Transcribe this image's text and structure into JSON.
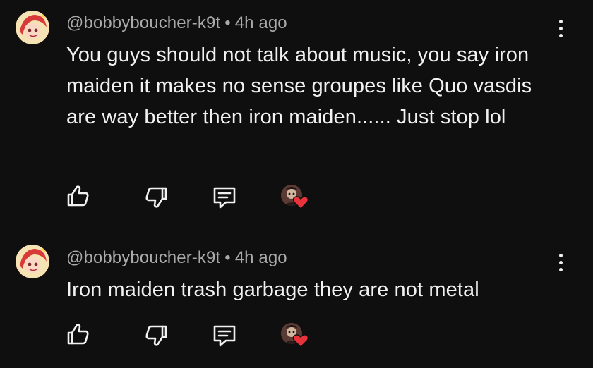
{
  "comments": [
    {
      "author": "@bobbyboucher-k9t",
      "separator": "•",
      "time": "4h ago",
      "text": "You guys should not talk about music, you say iron maiden it makes no sense groupes like Quo vasdis are way better then iron maiden...... Just stop lol",
      "icons": {
        "like": "thumbs-up-icon",
        "dislike": "thumbs-down-icon",
        "reply": "reply-comment-icon",
        "creator_heart": "creator-heart-icon",
        "more": "more-vertical-icon"
      }
    },
    {
      "author": "@bobbyboucher-k9t",
      "separator": "•",
      "time": "4h ago",
      "text": "Iron maiden trash garbage they are not metal",
      "icons": {
        "like": "thumbs-up-icon",
        "dislike": "thumbs-down-icon",
        "reply": "reply-comment-icon",
        "creator_heart": "creator-heart-icon",
        "more": "more-vertical-icon"
      }
    }
  ],
  "colors": {
    "background": "#0f0f0f",
    "text_primary": "#f1f1f1",
    "text_secondary": "#aaaaaa",
    "heart": "#e8333a"
  }
}
